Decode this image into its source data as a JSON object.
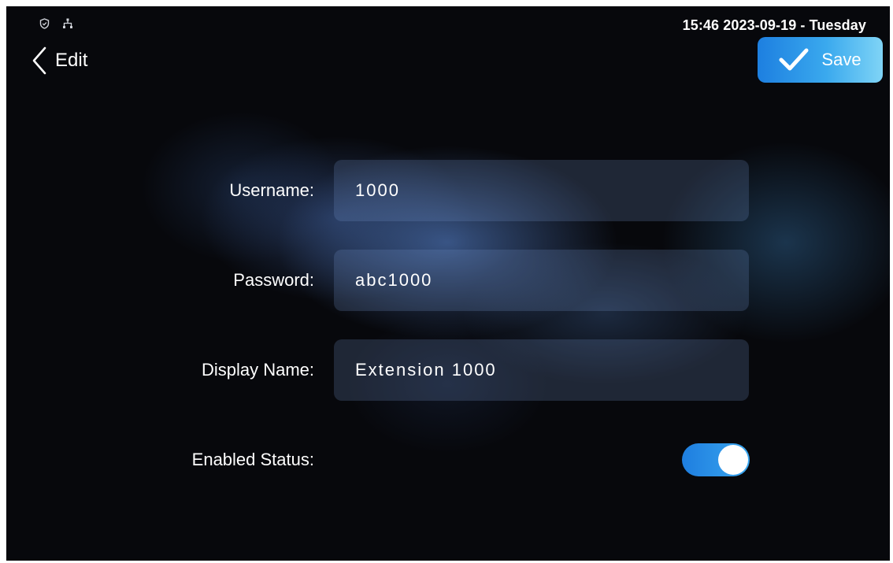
{
  "status_bar": {
    "icons": [
      "shield-icon",
      "network-icon"
    ],
    "datetime": "15:46  2023-09-19 - Tuesday"
  },
  "header": {
    "back_icon": "chevron-left-icon",
    "title": "Edit",
    "save_icon": "checkmark-icon",
    "save_label": "Save"
  },
  "form": {
    "username": {
      "label": "Username:",
      "value": "1000"
    },
    "password": {
      "label": "Password:",
      "value": "abc1000"
    },
    "display_name": {
      "label": "Display Name:",
      "value": "Extension 1000"
    },
    "enabled_status": {
      "label": "Enabled Status:",
      "enabled": true
    }
  },
  "colors": {
    "accent_start": "#1d7fe0",
    "accent_end": "#7fd4f6",
    "background": "#07080c",
    "field_bg": "#4f6790"
  }
}
